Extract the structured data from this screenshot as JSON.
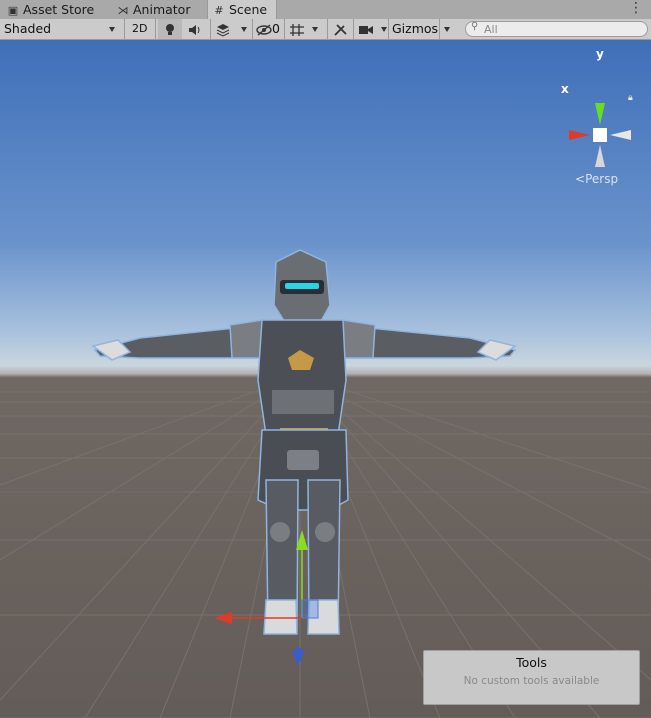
{
  "tabs": [
    {
      "label": "Asset Store",
      "icon": "shopping-bag-icon",
      "active": false
    },
    {
      "label": "Animator",
      "icon": "animator-icon",
      "active": false
    },
    {
      "label": "Scene",
      "icon": "grid-icon",
      "active": true
    }
  ],
  "toolbar": {
    "draw_mode": "Shaded",
    "mode_2d": "2D",
    "hidden_count": "0",
    "gizmos_label": "Gizmos"
  },
  "search": {
    "placeholder": "All"
  },
  "scene_gizmo": {
    "x_label": "x",
    "y_label": "y",
    "projection": "Persp"
  },
  "tools_overlay": {
    "title": "Tools",
    "subtitle": "No custom tools available"
  }
}
